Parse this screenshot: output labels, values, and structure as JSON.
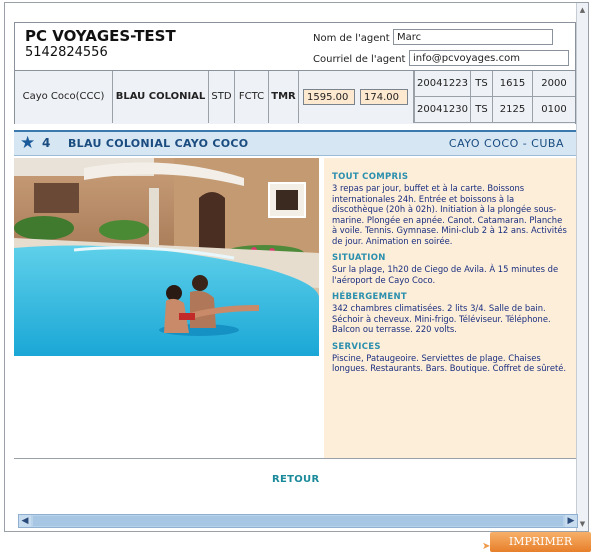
{
  "agency": {
    "name": "PC VOYAGES-TEST",
    "phone": "5142824556",
    "agent_label": "Nom de l'agent :",
    "agent_value": "Marc",
    "email_label": "Courriel de l'agent :",
    "email_value": "info@pcvoyages.com"
  },
  "trip": {
    "destination": "Cayo Coco(CCC)",
    "hotel": "BLAU COLONIAL",
    "room": "STD",
    "plan": "FCTC",
    "tmr": "TMR",
    "price1": "1595.00",
    "price2": "174.00",
    "dates": [
      {
        "date": "20041223",
        "code": "TS",
        "time1": "1615",
        "time2": "2000"
      },
      {
        "date": "20041230",
        "code": "TS",
        "time1": "2125",
        "time2": "0100"
      }
    ]
  },
  "hotel_bar": {
    "star_icon": "★",
    "stars": "4",
    "name": "BLAU COLONIAL CAYO COCO",
    "location": "CAYO COCO - CUBA"
  },
  "info": {
    "sections": [
      {
        "title": "TOUT COMPRIS",
        "text": "3 repas par jour, buffet et à la carte. Boissons internationales 24h. Entrée et boissons à la discothèque (20h à 02h). Initiation à la plongée sous-marine. Plongée en apnée. Canot. Catamaran. Planche à voile. Tennis. Gymnase. Mini-club 2 à 12 ans. Activités de jour. Animation en soirée."
      },
      {
        "title": "SITUATION",
        "text": "Sur la plage, 1h20 de Ciego de Avila. À 15 minutes de l'aéroport de Cayo Coco."
      },
      {
        "title": "HÉBERGEMENT",
        "text": "342 chambres climatisées. 2 lits 3/4. Salle de bain. Séchoir à cheveux. Mini-frigo. Téléviseur. Téléphone. Balcon ou terrasse. 220 volts."
      },
      {
        "title": "SERVICES",
        "text": "Piscine, Pataugeoire. Serviettes de plage. Chaises longues. Restaurants. Bars. Boutique. Coffret de sûreté."
      }
    ]
  },
  "actions": {
    "retour": "RETOUR",
    "print": "IMPRIMER"
  },
  "colors": {
    "accent_blue": "#1a4c80",
    "section_teal": "#2a8fae",
    "info_bg": "#fdeed9",
    "print_orange": "#e77f2a"
  }
}
